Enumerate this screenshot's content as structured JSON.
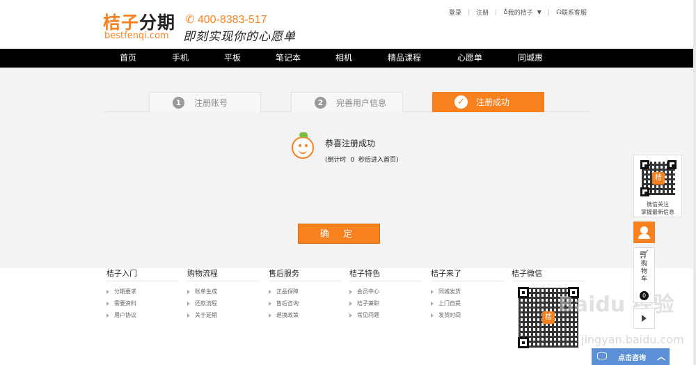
{
  "header": {
    "logo_prefix": "桔子",
    "logo_suffix": "分期",
    "logo_en": "bestfenqi.com",
    "phone": "400-8383-517",
    "slogan": "即刻实现你的心愿单",
    "links": {
      "login": "登录",
      "register": "注册",
      "my": "我的桔子",
      "contact": "联系客服"
    }
  },
  "nav": {
    "items": [
      {
        "label": "首页"
      },
      {
        "label": "手机"
      },
      {
        "label": "平板"
      },
      {
        "label": "笔记本"
      },
      {
        "label": "相机"
      },
      {
        "label": "精品课程"
      },
      {
        "label": "心愿单"
      },
      {
        "label": "同城惠"
      }
    ]
  },
  "steps": [
    {
      "num": "1",
      "label": "注册账号"
    },
    {
      "num": "2",
      "label": "完善用户信息"
    },
    {
      "num": "✓",
      "label": "注册成功"
    }
  ],
  "success": {
    "title": "恭喜注册成功",
    "countdown_prefix": "(倒计时",
    "countdown_value": "0",
    "countdown_suffix": "秒后进入首页)",
    "confirm": "确 定"
  },
  "footer": {
    "columns": [
      {
        "title": "桔子入门",
        "items": [
          "分期要求",
          "需要资料",
          "用户协议"
        ]
      },
      {
        "title": "购物流程",
        "items": [
          "账单生成",
          "还款流程",
          "关于延期"
        ]
      },
      {
        "title": "售后服务",
        "items": [
          "正品保障",
          "售后咨询",
          "退换政策"
        ]
      },
      {
        "title": "桔子特色",
        "items": [
          "会员中心",
          "桔子兼职",
          "常见问题"
        ]
      },
      {
        "title": "桔子来了",
        "items": [
          "同城发货",
          "上门自提",
          "发货时间"
        ]
      },
      {
        "title": "桔子微信",
        "items": []
      }
    ]
  },
  "sidebar": {
    "qr_center": "桔",
    "qr_text_line1": "微信关注",
    "qr_text_line2": "掌握最新信息",
    "cart_label": "购物车",
    "cart_count": "0"
  },
  "consult": {
    "label": "点击咨询"
  },
  "watermark": {
    "brand": "Baidu 经验",
    "url": "jingyan.baidu.com"
  },
  "colors": {
    "accent": "#f7811e",
    "nav_bg": "#000000",
    "consult": "#5b8fd6"
  }
}
